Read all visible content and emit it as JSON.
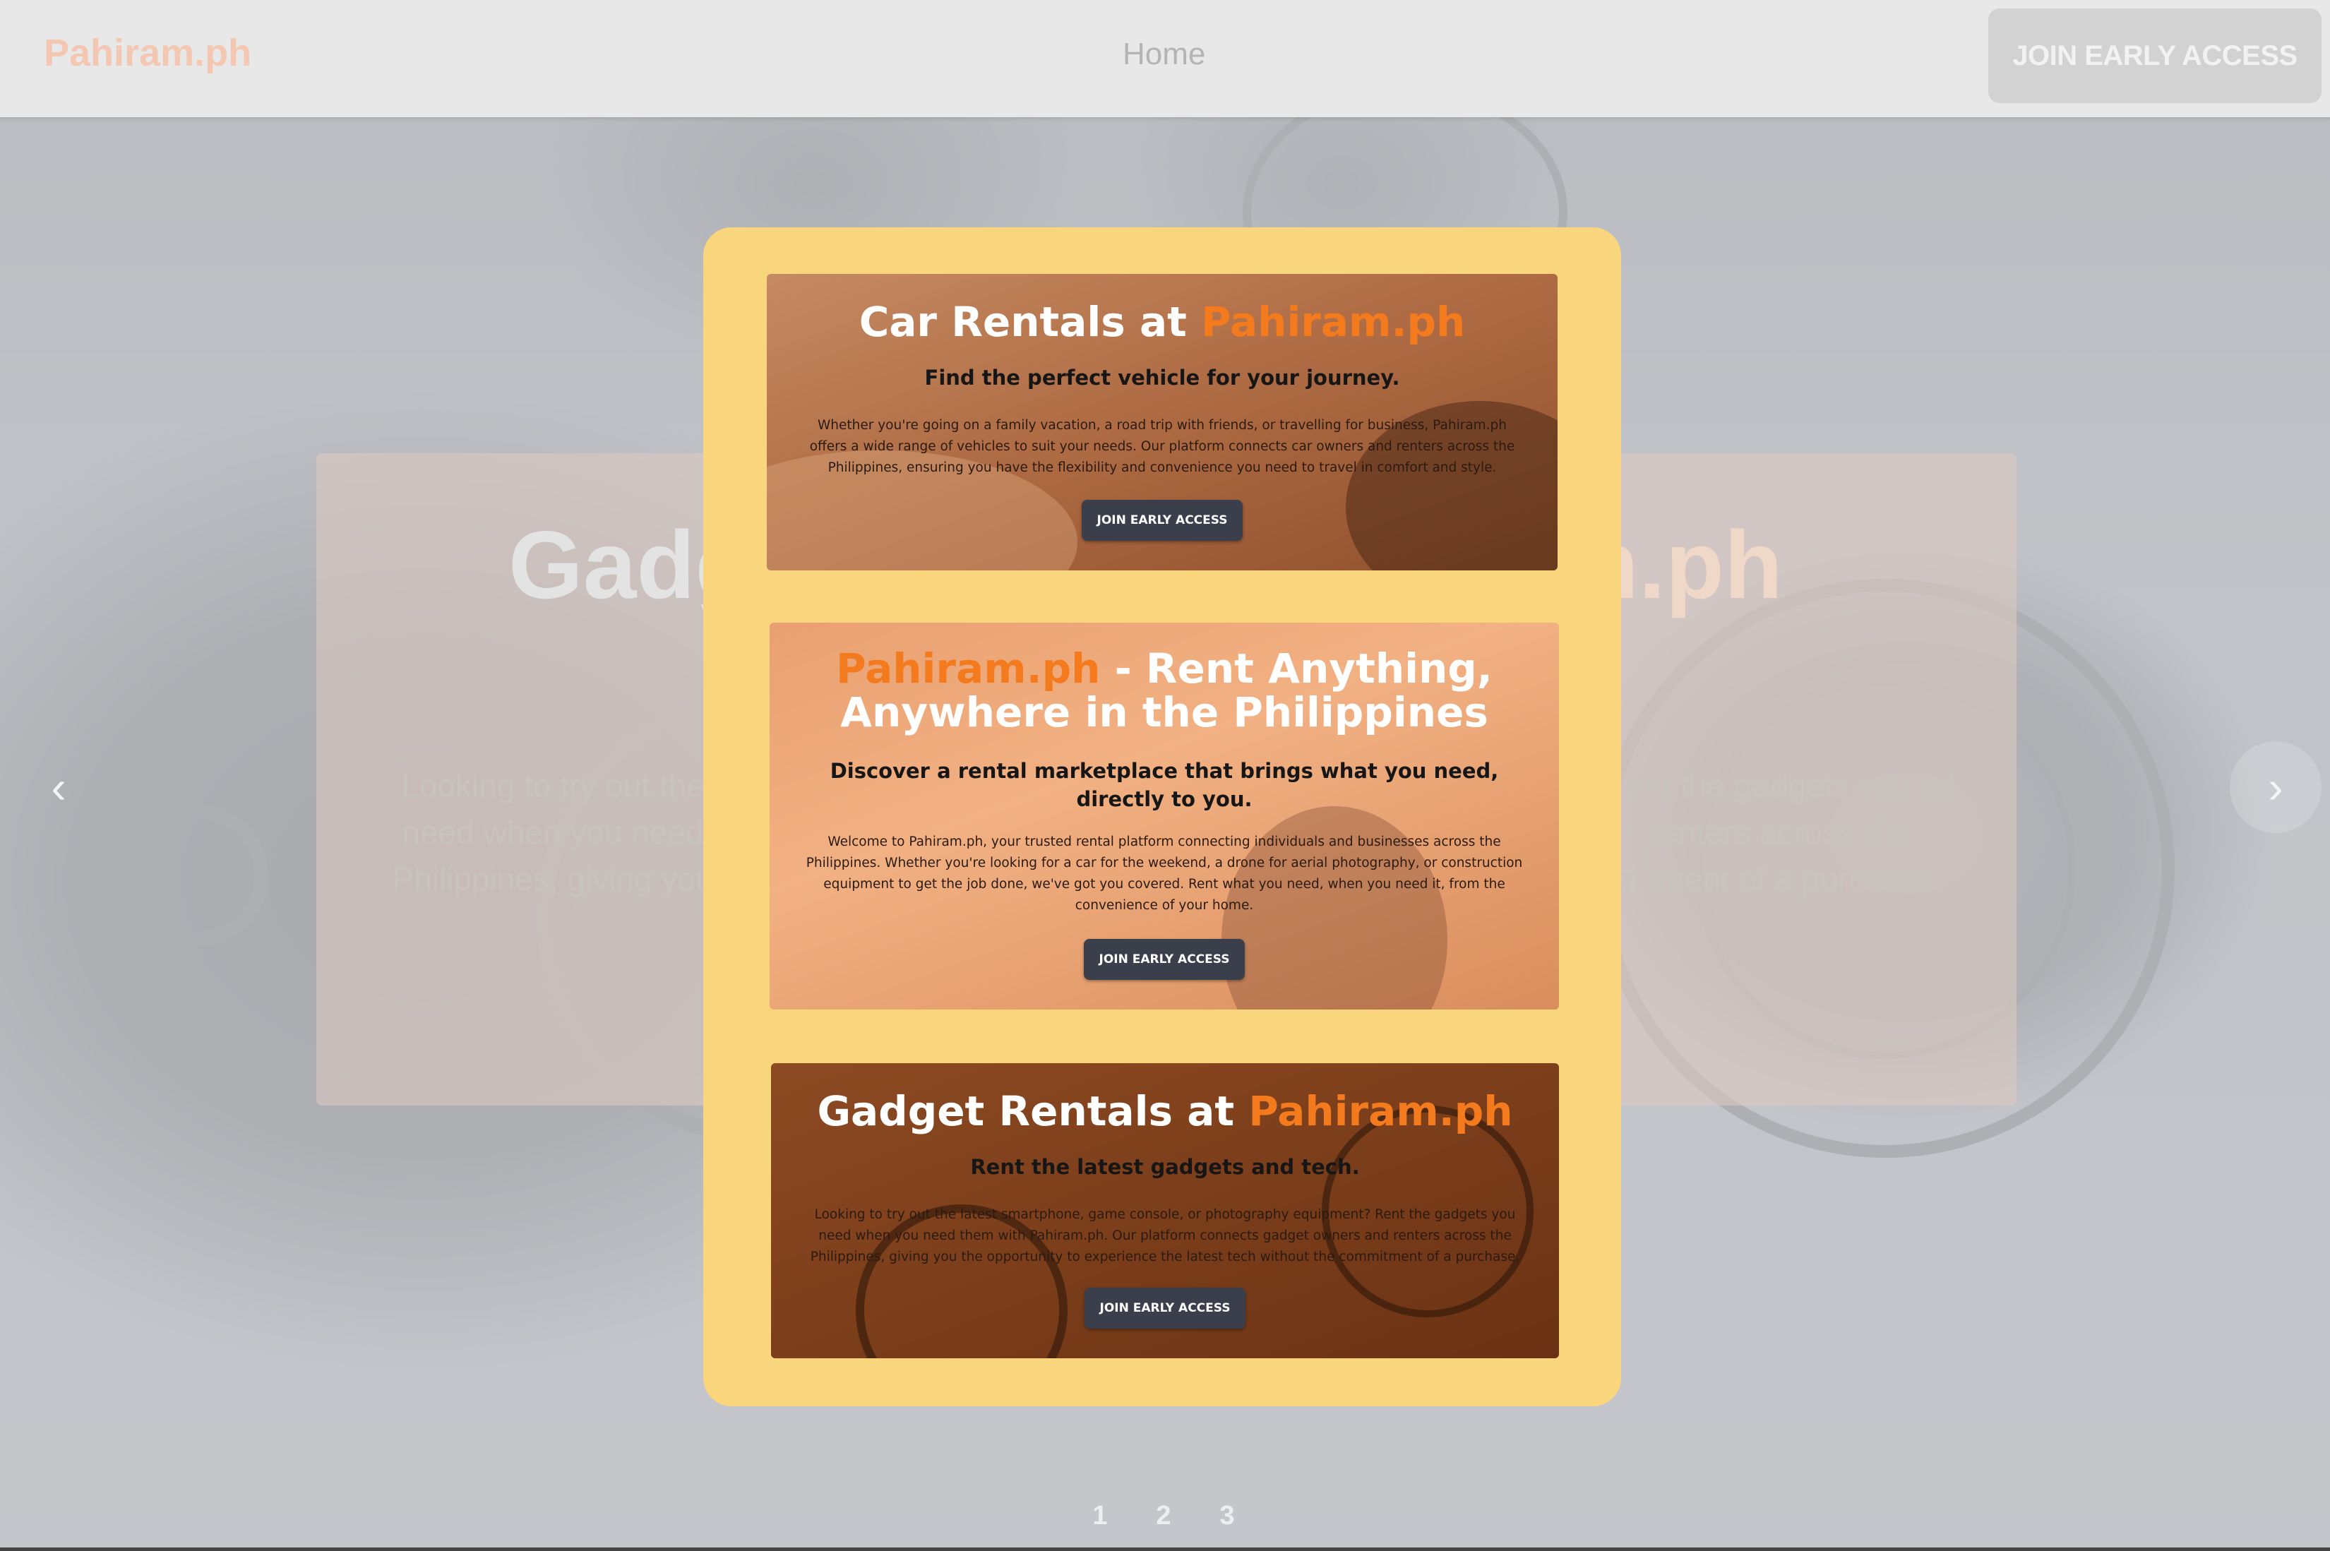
{
  "navbar": {
    "brand": "Pahiram.ph",
    "home_link": "Home",
    "cta_label": "JOIN EARLY ACCESS"
  },
  "carousel": {
    "slide_title_left": "Gadg",
    "slide_title_right": "m.ph",
    "slide_text_left": "Looking to try out the need when you need Philippines, giving you",
    "slide_text_right": "Rent the gadgets you nd renters across the mitment of a purchase.",
    "prev_arrow": "‹",
    "next_arrow": "›",
    "pages": [
      "1",
      "2",
      "3"
    ]
  },
  "modal": {
    "car": {
      "title_prefix": "Car Rentals at ",
      "title_brand": "Pahiram.ph",
      "subtitle": "Find the perfect vehicle for your journey.",
      "body": "Whether you're going on a family vacation, a road trip with friends, or travelling for business, Pahiram.ph offers a wide range of vehicles to suit your needs. Our platform connects car owners and renters across the Philippines, ensuring you have the flexibility and convenience you need to travel in comfort and style.",
      "button": "JOIN EARLY ACCESS"
    },
    "main": {
      "title_brand": "Pahiram.ph",
      "title_rest_line1": " - Rent Anything,",
      "title_line2": "Anywhere in the Philippines",
      "subtitle": "Discover a rental marketplace that brings what you need, directly to you.",
      "body": "Welcome to Pahiram.ph, your trusted rental platform connecting individuals and businesses across the Philippines. Whether you're looking for a car for the weekend, a drone for aerial photography, or construction equipment to get the job done, we've got you covered. Rent what you need, when you need it, from the convenience of your home.",
      "button": "JOIN EARLY ACCESS"
    },
    "gadget": {
      "title_prefix": "Gadget Rentals at ",
      "title_brand": "Pahiram.ph",
      "subtitle": "Rent the latest gadgets and tech.",
      "body": "Looking to try out the latest smartphone, game console, or photography equipment? Rent the gadgets you need when you need them with Pahiram.ph. Our platform connects gadget owners and renters across the Philippines, giving you the opportunity to experience the latest tech without the commitment of a purchase.",
      "button": "JOIN EARLY ACCESS"
    }
  }
}
